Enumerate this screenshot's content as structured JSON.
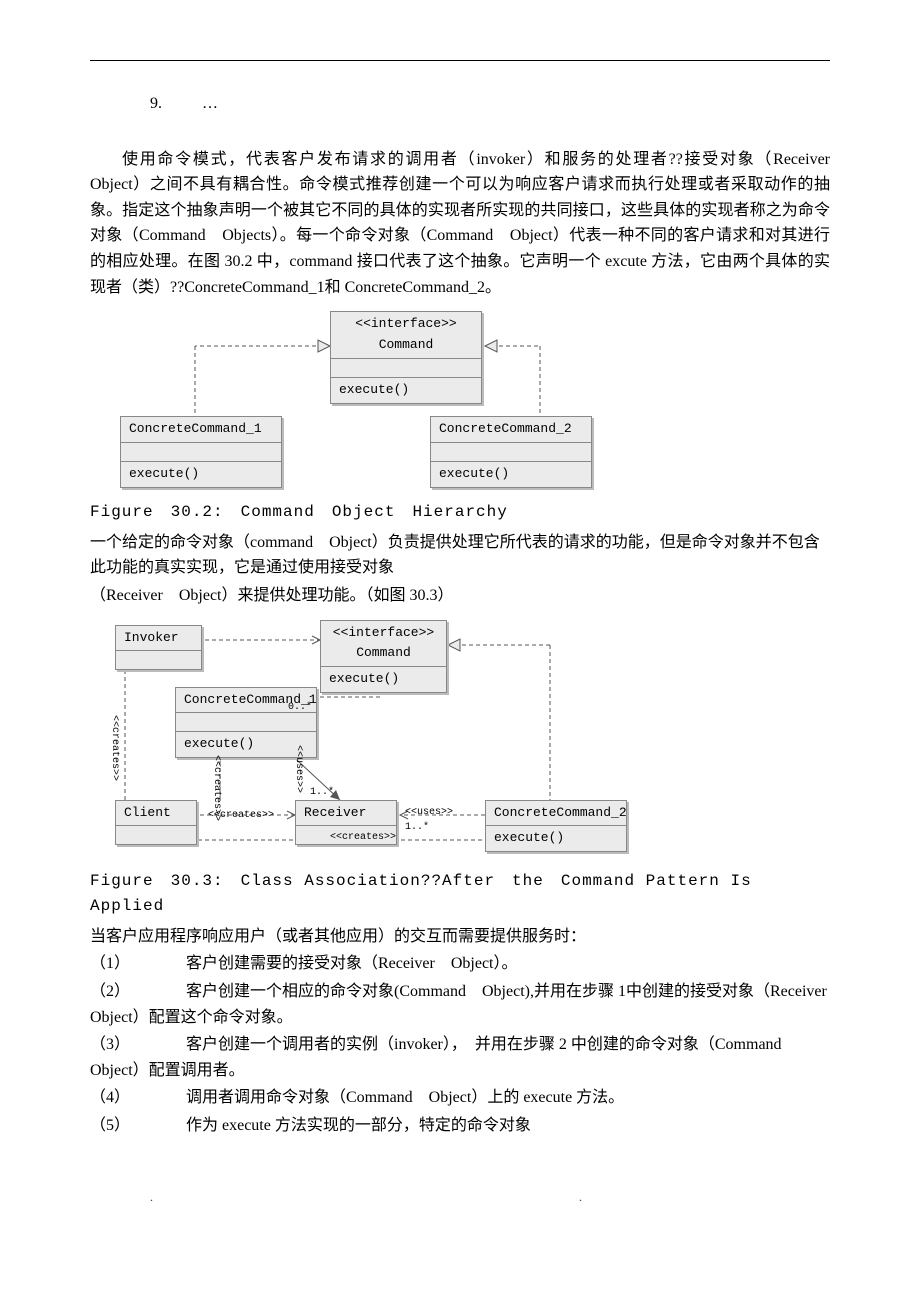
{
  "item_number": "9.",
  "ellipsis": "…",
  "paragraph1": "使用命令模式，代表客户发布请求的调用者（invoker）和服务的处理者??接受对象（Receiver　Object）之间不具有耦合性。命令模式推荐创建一个可以为响应客户请求而执行处理或者采取动作的抽象。指定这个抽象声明一个被其它不同的具体的实现者所实现的共同接口，这些具体的实现者称之为命令对象（Command　Objects）。每一个命令对象（Command　Object）代表一种不同的客户请求和对其进行的相应处理。在图 30.2 中，command 接口代表了这个抽象。它声明一个 excute 方法，它由两个具体的实现者（类）??ConcreteCommand_1和 ConcreteCommand_2。",
  "uml1": {
    "interface_tag": "<<interface>>",
    "interface_name": "Command",
    "execute": "execute()",
    "concrete1": "ConcreteCommand_1",
    "concrete2": "ConcreteCommand_2"
  },
  "fig1_caption": "Figure　30.2:　Command　Object　Hierarchy",
  "paragraph2_a": "一个给定的命令对象（command　Object）负责提供处理它所代表的请求的功能，但是命令对象并不包含此功能的真实实现，它是通过使用接受对象",
  "paragraph2_b": "（Receiver　Object）来提供处理功能。（如图 30.3）",
  "uml2": {
    "invoker": "Invoker",
    "interface_tag": "<<interface>>",
    "interface_name": "Command",
    "execute": "execute()",
    "concrete1": "ConcreteCommand_1",
    "concrete2": "ConcreteCommand_2",
    "receiver": "Receiver",
    "client": "Client",
    "creates": "<<creates>>",
    "uses": "<<uses>>",
    "mult_0star": "0..*",
    "mult_1star": "1..*"
  },
  "fig2_caption": "Figure　30.3:　Class Association??After　the　Command Pattern Is Applied",
  "paragraph3": "当客户应用程序响应用户（或者其他应用）的交互而需要提供服务时：",
  "steps": {
    "s1": "（1）　　　　客户创建需要的接受对象（Receiver　Object）。",
    "s2": "（2）　　　　客户创建一个相应的命令对象(Command　Object),并用在步骤 1中创建的接受对象（Receiver　Object）配置这个命令对象。",
    "s3": "（3）　　　　客户创建一个调用者的实例（invoker），　并用在步骤 2 中创建的命令对象（Command　Object）配置调用者。",
    "s4": "（4）　　　　调用者调用命令对象（Command　Object）上的 execute 方法。",
    "s5": "（5）　　　　作为 execute 方法实现的一部分，特定的命令对象"
  },
  "footer_dots": ".   .   ."
}
